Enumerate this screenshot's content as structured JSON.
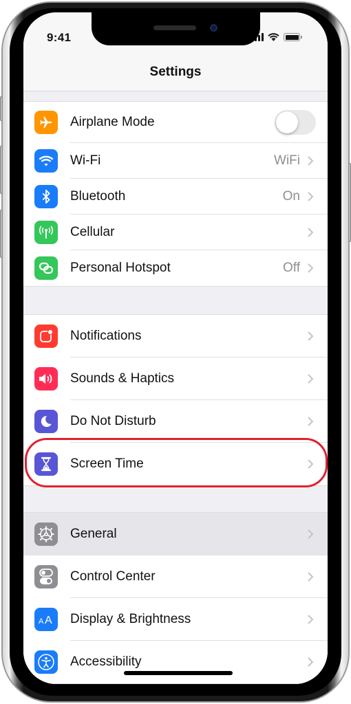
{
  "status_bar": {
    "time": "9:41",
    "icons": [
      "cellular-signal-icon",
      "wifi-icon",
      "battery-icon"
    ]
  },
  "header": {
    "title": "Settings"
  },
  "colors": {
    "orange": "#ff9500",
    "blue": "#1a7cf9",
    "green": "#34c759",
    "red": "#ff3b30",
    "pink": "#ff2d55",
    "indigo": "#5856d6",
    "gray": "#8e8e93",
    "highlight_ring": "#e0212e"
  },
  "groups": [
    {
      "items": [
        {
          "id": "airplane-mode",
          "label": "Airplane Mode",
          "icon": "airplane-icon",
          "color": "#ff9500",
          "control": "toggle",
          "toggle_on": false
        },
        {
          "id": "wifi",
          "label": "Wi-Fi",
          "icon": "wifi-icon",
          "color": "#1a7cf9",
          "value": "WiFi"
        },
        {
          "id": "bluetooth",
          "label": "Bluetooth",
          "icon": "bluetooth-icon",
          "color": "#1a7cf9",
          "value": "On"
        },
        {
          "id": "cellular",
          "label": "Cellular",
          "icon": "antenna-icon",
          "color": "#34c759",
          "value": ""
        },
        {
          "id": "personal-hotspot",
          "label": "Personal Hotspot",
          "icon": "hotspot-chain-icon",
          "color": "#34c759",
          "value": "Off"
        }
      ]
    },
    {
      "items": [
        {
          "id": "notifications",
          "label": "Notifications",
          "icon": "notifications-icon",
          "color": "#ff3b30",
          "value": ""
        },
        {
          "id": "sounds-haptics",
          "label": "Sounds & Haptics",
          "icon": "speaker-icon",
          "color": "#ff2d55",
          "value": ""
        },
        {
          "id": "do-not-disturb",
          "label": "Do Not Disturb",
          "icon": "moon-icon",
          "color": "#5856d6",
          "value": ""
        },
        {
          "id": "screen-time",
          "label": "Screen Time",
          "icon": "hourglass-icon",
          "color": "#5856d6",
          "value": "",
          "circled": true
        }
      ]
    },
    {
      "items": [
        {
          "id": "general",
          "label": "General",
          "icon": "gear-icon",
          "color": "#8e8e93",
          "value": "",
          "highlighted": true
        },
        {
          "id": "control-center",
          "label": "Control Center",
          "icon": "switches-icon",
          "color": "#8e8e93",
          "value": ""
        },
        {
          "id": "display-brightness",
          "label": "Display & Brightness",
          "icon": "text-size-icon",
          "color": "#1a7cf9",
          "value": ""
        },
        {
          "id": "accessibility",
          "label": "Accessibility",
          "icon": "accessibility-icon",
          "color": "#1a7cf9",
          "value": ""
        }
      ]
    }
  ]
}
